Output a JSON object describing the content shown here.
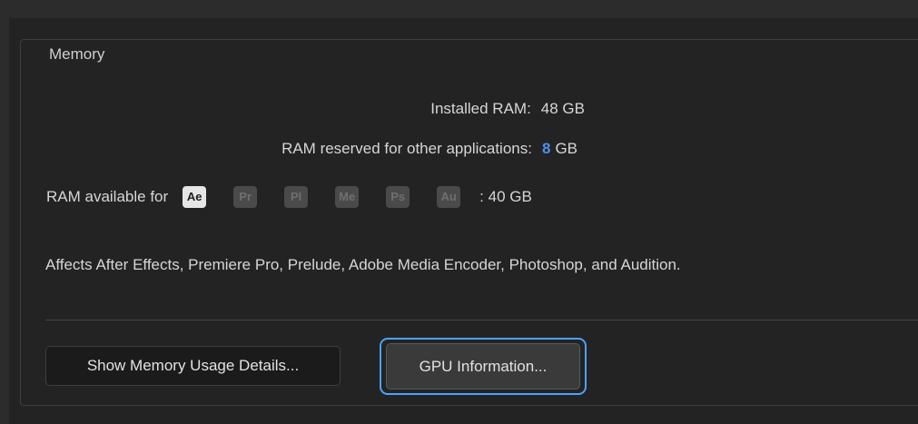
{
  "memory": {
    "legend": "Memory",
    "installed_label": "Installed RAM:",
    "installed_value": "48 GB",
    "reserved_label": "RAM reserved for other applications:",
    "reserved_value": "8",
    "reserved_unit": "GB",
    "available_label": "RAM available for",
    "apps": [
      {
        "abbr": "Ae",
        "active": true
      },
      {
        "abbr": "Pr",
        "active": false
      },
      {
        "abbr": "Pl",
        "active": false
      },
      {
        "abbr": "Me",
        "active": false
      },
      {
        "abbr": "Ps",
        "active": false
      },
      {
        "abbr": "Au",
        "active": false
      }
    ],
    "available_value": ": 40 GB",
    "note": "Affects After Effects, Premiere Pro, Prelude, Adobe Media Encoder, Photoshop, and Audition."
  },
  "buttons": {
    "memory_details": "Show Memory Usage Details...",
    "gpu_info": "GPU Information..."
  },
  "colors": {
    "accent_value": "#4e8ff0",
    "focus_ring": "#4aa2ff",
    "background": "#232323"
  }
}
